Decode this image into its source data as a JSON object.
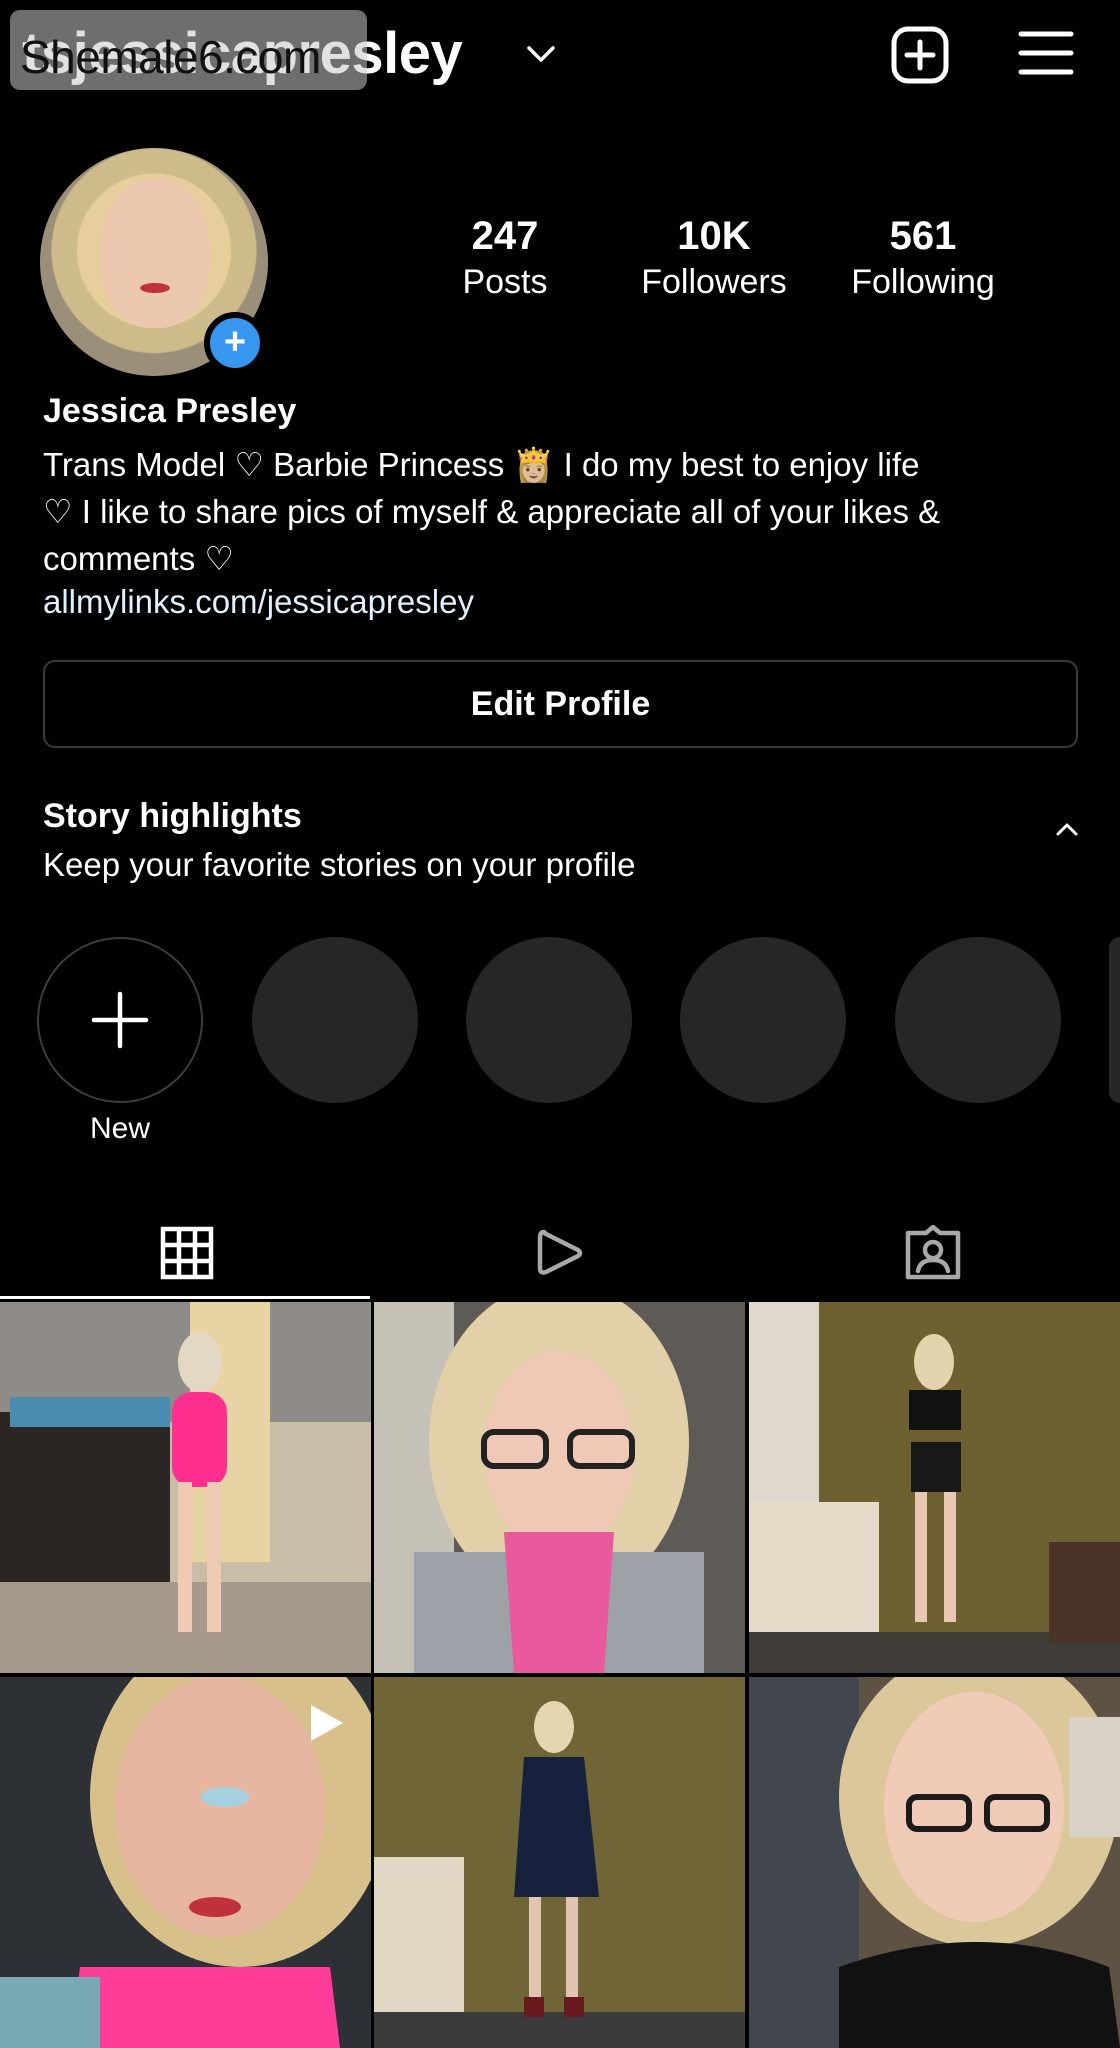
{
  "header": {
    "username": "tsjessicapresley",
    "watermark": "Shemale6.com"
  },
  "profile": {
    "stats": [
      {
        "count": "247",
        "label": "Posts"
      },
      {
        "count": "10K",
        "label": "Followers"
      },
      {
        "count": "561",
        "label": "Following"
      }
    ],
    "full_name": "Jessica Presley",
    "bio_line1": "Trans Model ♡ Barbie Princess 👸🏼 I do my best to enjoy life",
    "bio_line2": "♡ I like to share pics of myself & appreciate all of your likes &",
    "bio_line3": "comments ♡",
    "link": "allmylinks.com/jessicapresley",
    "edit_button": "Edit Profile"
  },
  "highlights": {
    "title": "Story highlights",
    "subtitle": "Keep your favorite stories on your profile",
    "new_label": "New"
  },
  "tabs": [
    {
      "icon": "grid-icon",
      "active": true
    },
    {
      "icon": "reels-icon",
      "active": false
    },
    {
      "icon": "tagged-icon",
      "active": false
    }
  ],
  "posts": [
    {
      "type": "photo",
      "palette": "pink-swimsuit-desert"
    },
    {
      "type": "photo",
      "palette": "glasses-pink-scarf"
    },
    {
      "type": "photo",
      "palette": "black-outfit-curtains"
    },
    {
      "type": "reel",
      "palette": "pink-swimsuit-closeup"
    },
    {
      "type": "photo",
      "palette": "navy-dress-curtains"
    },
    {
      "type": "photo",
      "palette": "glasses-black-top"
    }
  ],
  "colors": {
    "background": "#000000",
    "accent_blue": "#3797f0",
    "placeholder_circle": "#262626",
    "button_border": "#3a3a3a"
  }
}
